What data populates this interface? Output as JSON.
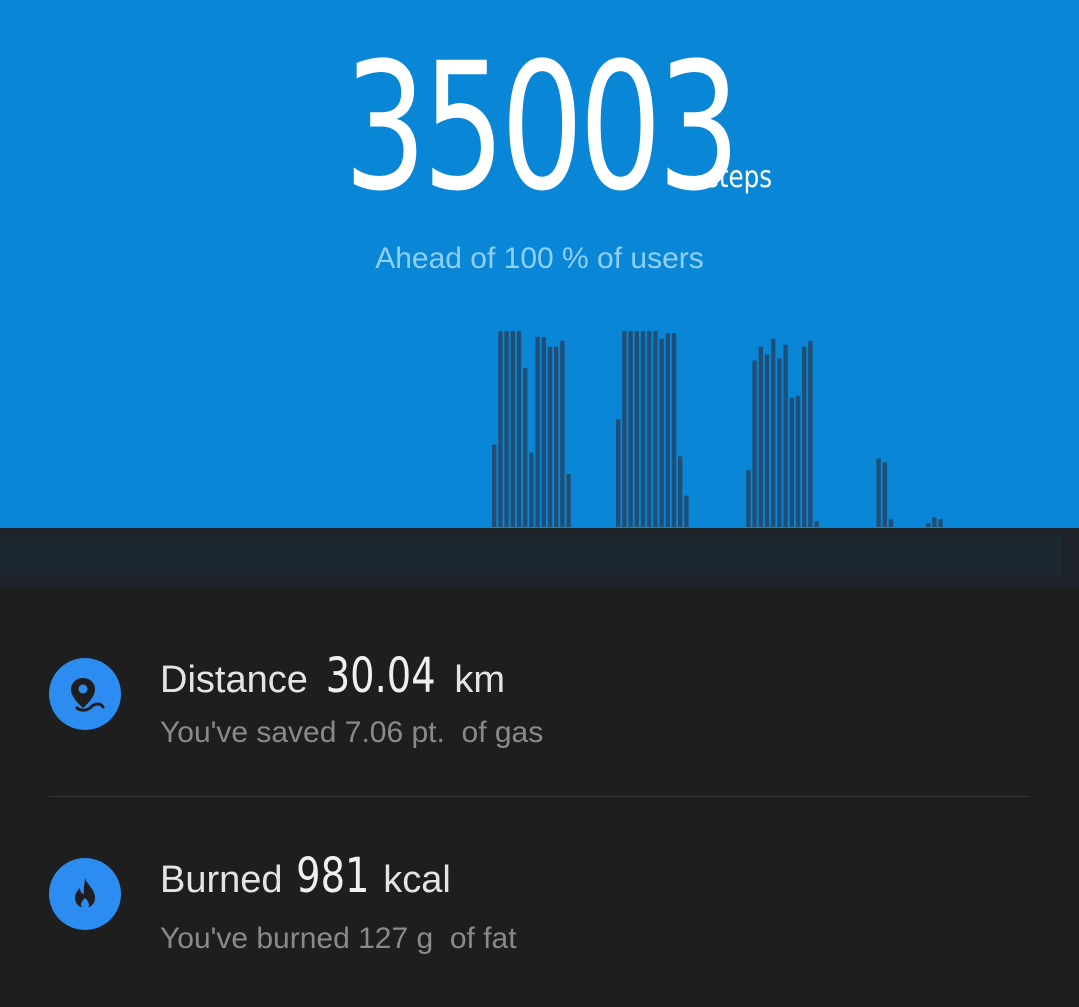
{
  "hero": {
    "steps_count": "35003",
    "steps_unit": "steps",
    "ahead_text": "Ahead of 100 % of users",
    "background_color": "#0a86d6"
  },
  "activity_chart": {
    "bar_color": "#1f4f76",
    "values": [
      0.42,
      1,
      1,
      1,
      1,
      0.81,
      0.38,
      0.97,
      0.97,
      0.92,
      0.92,
      0.95,
      0.27,
      0,
      0,
      0,
      0,
      0,
      0,
      0,
      0.55,
      1,
      1,
      1,
      1,
      1,
      1,
      0.96,
      0.99,
      0.99,
      0.36,
      0.16,
      0,
      0,
      0,
      0,
      0,
      0,
      0,
      0,
      0,
      0.29,
      0.85,
      0.92,
      0.88,
      0.96,
      0.86,
      0.93,
      0.66,
      0.67,
      0.92,
      0.95,
      0.03,
      0,
      0,
      0,
      0,
      0,
      0,
      0,
      0,
      0,
      0.35,
      0.33,
      0.04,
      0,
      0,
      0,
      0,
      0,
      0.02,
      0.05,
      0.04
    ]
  },
  "distance_card": {
    "icon": "map-pin-route-icon",
    "label": "Distance",
    "value": "30.04",
    "unit": "km",
    "subtitle": "You've saved 7.06 pt.  of gas"
  },
  "calorie_card": {
    "icon": "flame-icon",
    "label": "Burned",
    "value": "981",
    "unit": "kcal",
    "subtitle": "You've burned 127 g  of fat"
  }
}
